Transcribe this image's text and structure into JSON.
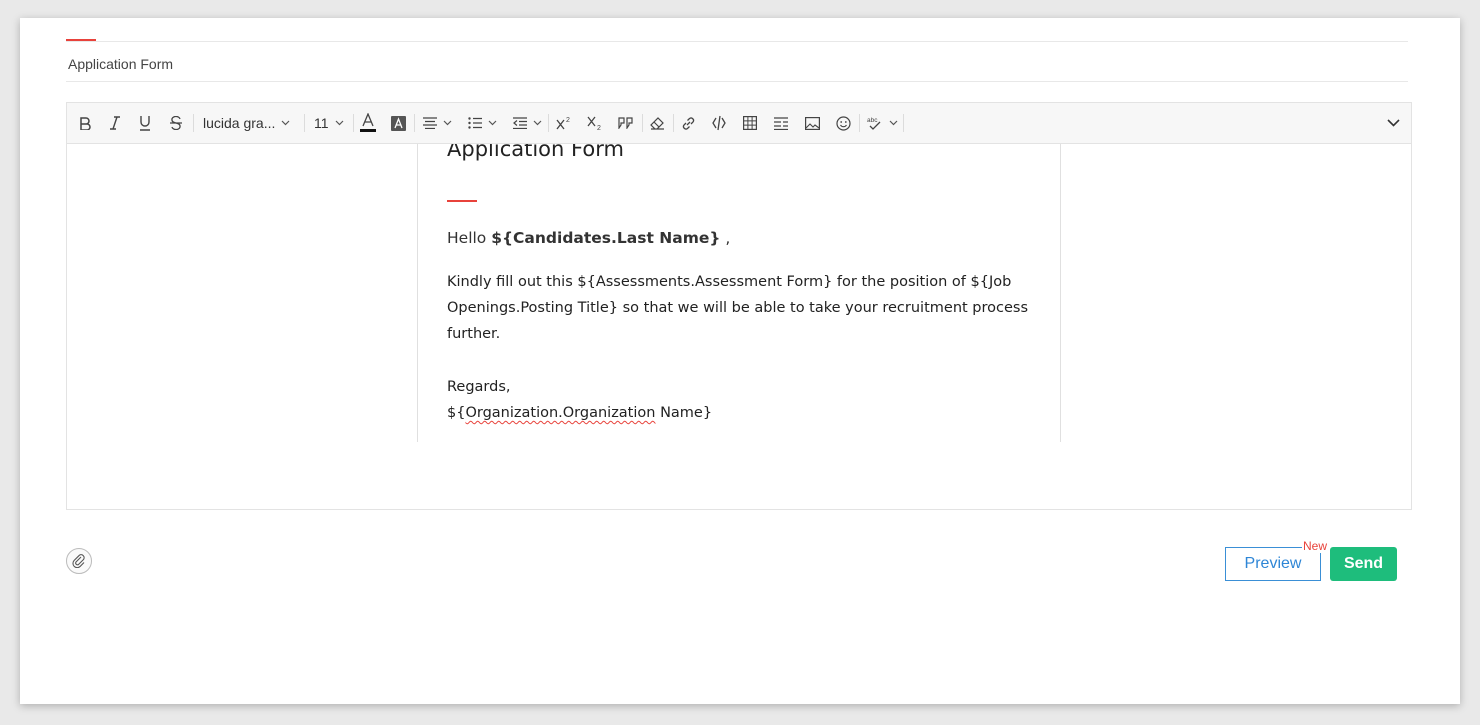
{
  "subject": "Application Form",
  "toolbar": {
    "font_family": "lucida gra...",
    "font_size": "11",
    "icons": [
      "bold-icon",
      "italic-icon",
      "underline-icon",
      "strikethrough-icon",
      "font-color-icon",
      "background-color-icon",
      "align-icon",
      "bulleted-list-icon",
      "indent-icon",
      "superscript-icon",
      "subscript-icon",
      "blockquote-icon",
      "clear-format-icon",
      "link-icon",
      "merge-field-icon",
      "table-icon",
      "line-spacing-icon",
      "image-icon",
      "emoji-icon",
      "spellcheck-icon",
      "collapse-toolbar-icon"
    ]
  },
  "document": {
    "title": "Application Form",
    "greeting_prefix": "Hello ",
    "greeting_field": "${Candidates.Last Name}",
    "greeting_suffix": " ,",
    "body": "Kindly fill out this ${Assessments.Assessment Form} for the position of ${Job Openings.Posting Title} so that we will be able to take your recruitment process further.",
    "regards": "Regards,",
    "signature_prefix": "${",
    "signature_misspelled": "Organization.Organization",
    "signature_suffix": " Name}"
  },
  "actions": {
    "preview_label": "Preview",
    "new_badge": "New",
    "send_label": "Send"
  },
  "colors": {
    "accent_red": "#e8423b",
    "preview_blue": "#2e86d6",
    "send_green": "#1ebd7c"
  }
}
